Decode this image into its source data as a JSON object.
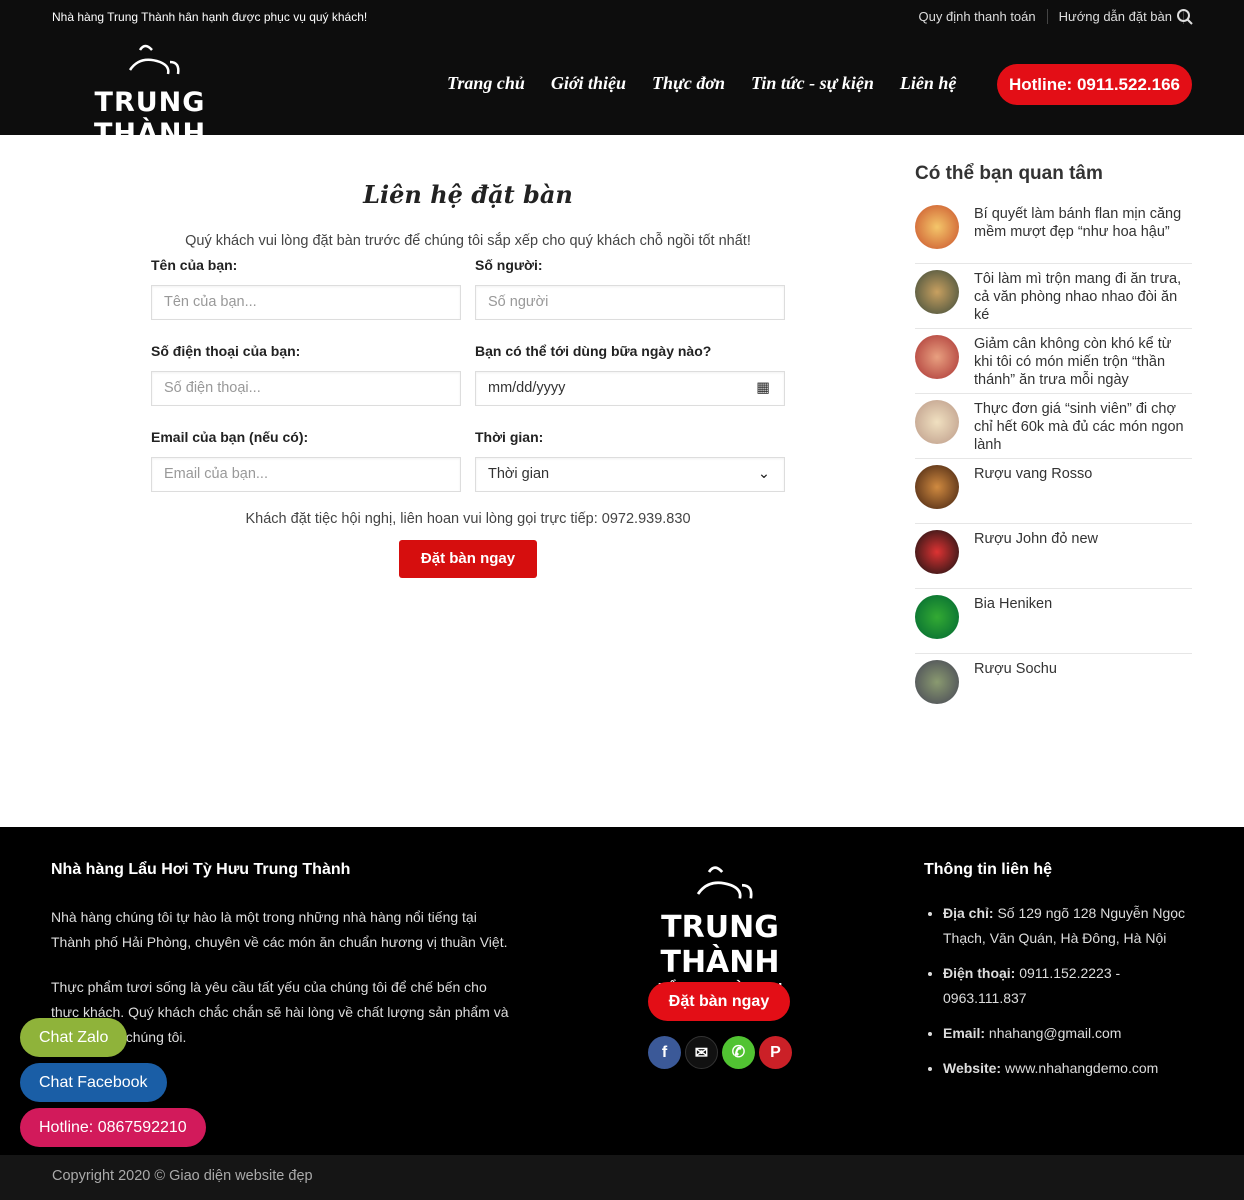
{
  "header": {
    "top_message": "Nhà hàng Trung Thành hân hạnh được phục vụ quý khách!",
    "top_links": [
      "Quy định thanh toán",
      "Hướng dẫn đặt bàn"
    ],
    "logo": {
      "name": "TRUNG THÀNH",
      "tagline": "LẨU HƠI TỲ HƯU"
    },
    "nav": [
      "Trang chủ",
      "Giới thiệu",
      "Thực đơn",
      "Tin tức - sự kiện",
      "Liên hệ"
    ],
    "hotline": "Hotline: 0911.522.166"
  },
  "form": {
    "title": "Liên hệ đặt bàn",
    "description": "Quý khách vui lòng đặt bàn trước để chúng tôi sắp xếp cho quý khách chỗ ngồi tốt nhất!",
    "fields": [
      {
        "label": "Tên của bạn:",
        "placeholder": "Tên của bạn..."
      },
      {
        "label": "Số người:",
        "placeholder": "Số người"
      },
      {
        "label": "Số điện thoại của bạn:",
        "placeholder": "Số điện thoại..."
      },
      {
        "label": "Bạn có thể tới dùng bữa ngày nào?",
        "placeholder": "mm/dd/yyyy"
      },
      {
        "label": "Email của bạn (nếu có):",
        "placeholder": "Email của bạn..."
      },
      {
        "label": "Thời gian:",
        "placeholder": "Thời gian"
      }
    ],
    "note": "Khách đặt tiệc hội nghị, liên hoan vui lòng gọi trực tiếp: 0972.939.830",
    "submit": "Đặt bàn ngay"
  },
  "sidebar": {
    "title": "Có thể bạn quan tâm",
    "items": [
      "Bí quyết làm bánh flan mịn căng mềm mượt đẹp “như hoa hậu”",
      "Tôi làm mì trộn mang đi ăn trưa, cả văn phòng nhao nhao đòi ăn ké",
      "Giảm cân không còn khó kể từ khi tôi có món miến trộn “thần thánh” ăn trưa mỗi ngày",
      "Thực đơn giá “sinh viên” đi chợ chỉ hết 60k mà đủ các món ngon lành",
      "Rượu vang Rosso",
      "Rượu John đỏ new",
      "Bia Heniken",
      "Rượu Sochu"
    ]
  },
  "footer": {
    "col1_title": "Nhà hàng Lẩu Hơi Tỳ Hưu Trung Thành",
    "p1": "Nhà hàng chúng tôi tự hào là một trong những nhà hàng nổi tiếng tại Thành phố Hải Phòng, chuyên về các món ăn chuẩn hương vị thuần Việt.",
    "p2": "Thực phẩm tươi sống là yêu cầu tất yếu của chúng tôi để chế bến cho thực khách. Quý khách chắc chắn sẽ hài lòng về chất lượng sản phẩm và dịch vụ của chúng tôi.",
    "button": "Đặt bàn ngay",
    "contact_title": "Thông tin liên hệ",
    "contacts": [
      {
        "k": "Địa chỉ:",
        "v": " Số 129 ngõ 128 Nguyễn Ngọc Thạch, Văn Quán, Hà Đông, Hà Nội"
      },
      {
        "k": "Điện thoại:",
        "v": " 0911.152.2223 - 0963.111.837"
      },
      {
        "k": "Email:",
        "v": " nhahang@gmail.com"
      },
      {
        "k": "Website:",
        "v": " www.nhahangdemo.com"
      }
    ],
    "copyright": "Copyright 2020 © Giao diện website đẹp"
  },
  "floating": {
    "zalo": "Chat Zalo",
    "facebook": "Chat Facebook",
    "hotline": "Hotline: 0867592210"
  }
}
